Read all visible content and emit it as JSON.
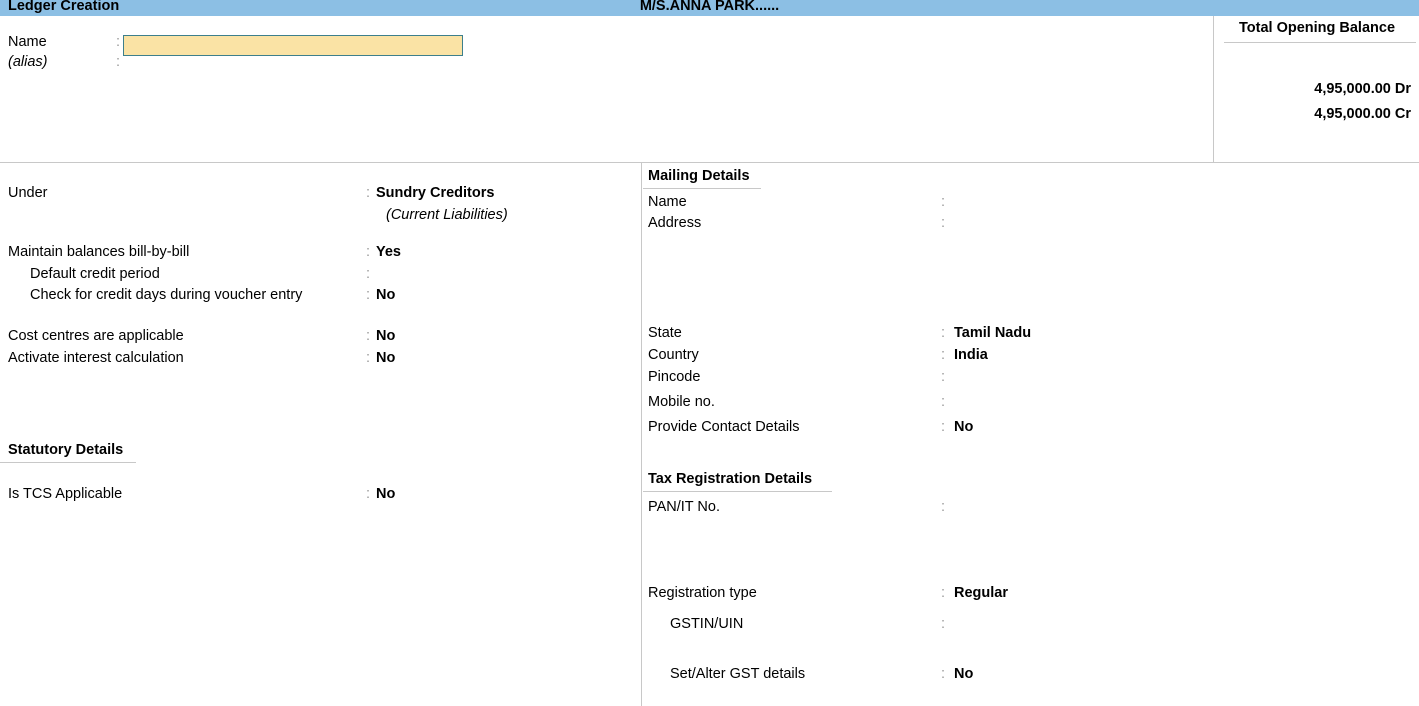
{
  "titlebar": {
    "screen_title": "Ledger Creation",
    "company_title": "M/S.ANNA PARK......",
    "background_color": "#8CBFE4"
  },
  "identity": {
    "name_label": "Name",
    "name_value": "",
    "name_placeholder": "",
    "alias_label": "(alias)",
    "alias_value": "",
    "colon": ":",
    "field_fill_color": "#FAE3A5",
    "field_border_color": "#3D7F8C"
  },
  "opening_balance": {
    "heading": "Total Opening Balance",
    "debit": "4,95,000.00 Dr",
    "credit": "4,95,000.00 Cr"
  },
  "left_column": {
    "under": {
      "label": "Under",
      "colon": ":",
      "value": "Sundry Creditors",
      "group_note": "(Current Liabilities)"
    },
    "bill_by_bill": {
      "label": "Maintain balances bill-by-bill",
      "colon": ":",
      "value": "Yes"
    },
    "default_credit_period": {
      "label": "Default credit period",
      "colon": ":",
      "value": ""
    },
    "check_credit_days": {
      "label": "Check for credit days during voucher entry",
      "colon": ":",
      "value": "No"
    },
    "cost_centres": {
      "label": "Cost centres are applicable",
      "colon": ":",
      "value": "No"
    },
    "interest_calculation": {
      "label": "Activate interest calculation",
      "colon": ":",
      "value": "No"
    },
    "statutory_heading": "Statutory Details",
    "is_tcs_applicable": {
      "label": "Is TCS Applicable",
      "colon": ":",
      "value": "No"
    }
  },
  "right_column": {
    "mailing_heading": "Mailing Details",
    "mailing_name": {
      "label": "Name",
      "colon": ":",
      "value": ""
    },
    "mailing_address": {
      "label": "Address",
      "colon": ":",
      "value": ""
    },
    "state": {
      "label": "State",
      "colon": ":",
      "value": "Tamil Nadu"
    },
    "country": {
      "label": "Country",
      "colon": ":",
      "value": "India"
    },
    "pincode": {
      "label": "Pincode",
      "colon": ":",
      "value": ""
    },
    "mobile_no": {
      "label": "Mobile no.",
      "colon": ":",
      "value": ""
    },
    "provide_contact_details": {
      "label": "Provide Contact Details",
      "colon": ":",
      "value": "No"
    },
    "tax_heading": "Tax Registration Details",
    "pan_it_no": {
      "label": "PAN/IT No.",
      "colon": ":",
      "value": ""
    },
    "registration_type": {
      "label": "Registration type",
      "colon": ":",
      "value": "Regular"
    },
    "gstin_uin": {
      "label": "GSTIN/UIN",
      "colon": ":",
      "value": ""
    },
    "set_alter_gst": {
      "label": "Set/Alter GST details",
      "colon": ":",
      "value": "No"
    }
  }
}
